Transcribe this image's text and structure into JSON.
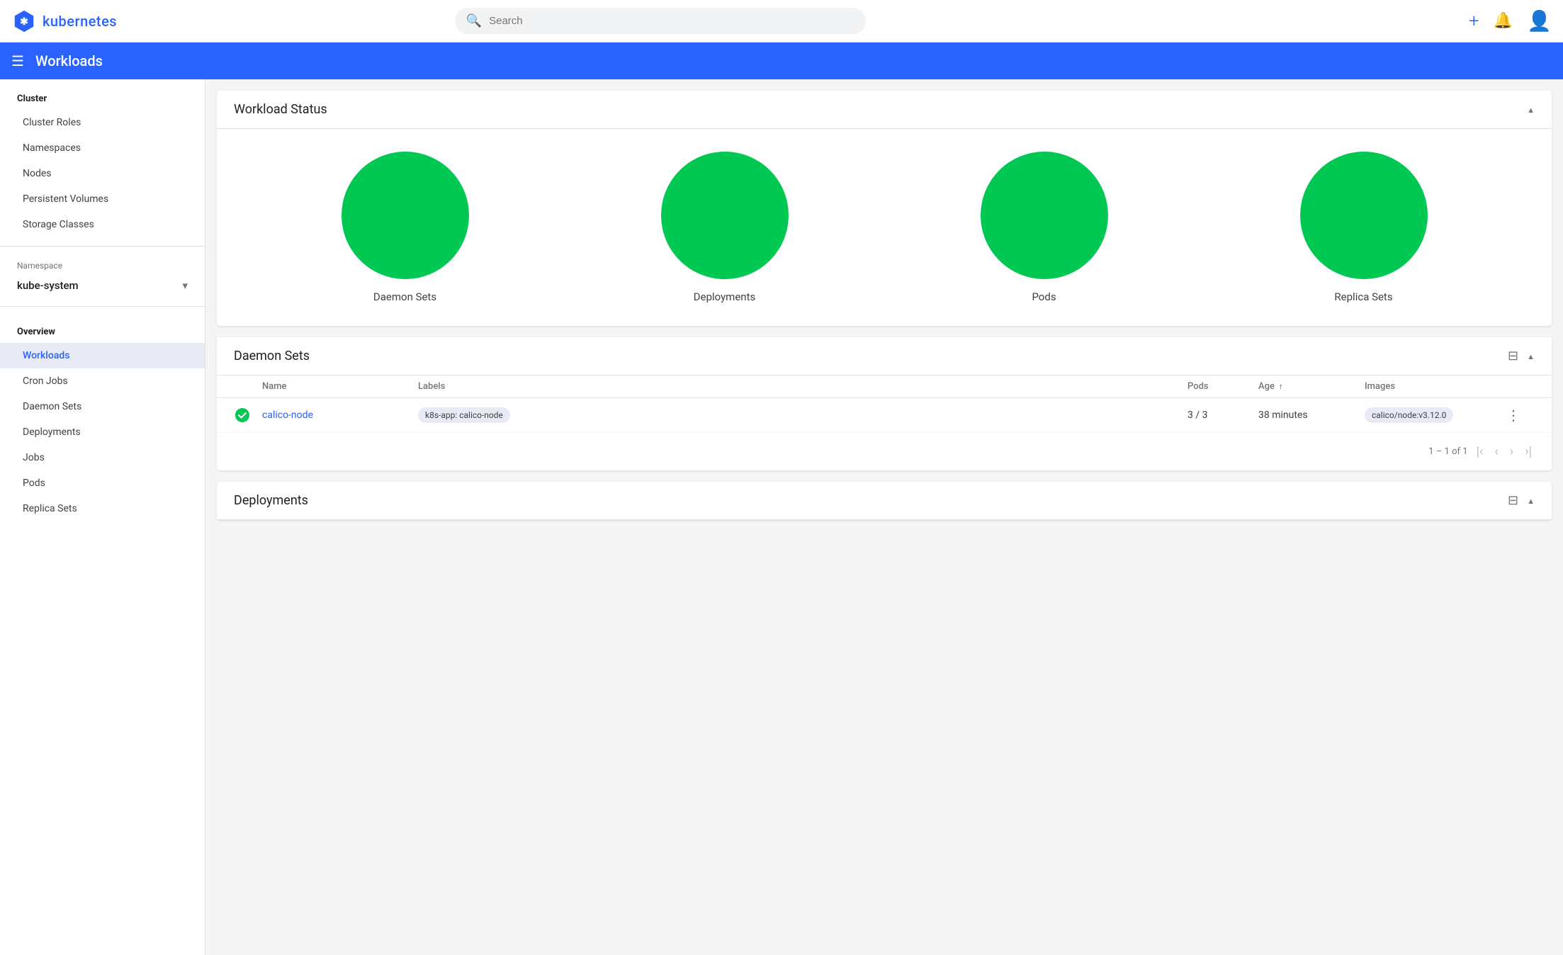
{
  "topbar": {
    "logo_text": "kubernetes",
    "search_placeholder": "Search"
  },
  "navbar": {
    "title": "Workloads"
  },
  "sidebar": {
    "cluster_header": "Cluster",
    "cluster_items": [
      {
        "label": "Cluster Roles",
        "id": "cluster-roles"
      },
      {
        "label": "Namespaces",
        "id": "namespaces"
      },
      {
        "label": "Nodes",
        "id": "nodes"
      },
      {
        "label": "Persistent Volumes",
        "id": "persistent-volumes"
      },
      {
        "label": "Storage Classes",
        "id": "storage-classes"
      }
    ],
    "namespace_label": "Namespace",
    "namespace_value": "kube-system",
    "overview_header": "Overview",
    "overview_items": [
      {
        "label": "Workloads",
        "id": "workloads",
        "active": true
      },
      {
        "label": "Cron Jobs",
        "id": "cron-jobs"
      },
      {
        "label": "Daemon Sets",
        "id": "daemon-sets"
      },
      {
        "label": "Deployments",
        "id": "deployments"
      },
      {
        "label": "Jobs",
        "id": "jobs"
      },
      {
        "label": "Pods",
        "id": "pods"
      },
      {
        "label": "Replica Sets",
        "id": "replica-sets"
      }
    ]
  },
  "workload_status": {
    "title": "Workload Status",
    "items": [
      {
        "label": "Daemon Sets",
        "color": "#00c853",
        "size": 180
      },
      {
        "label": "Deployments",
        "color": "#00c853",
        "size": 180
      },
      {
        "label": "Pods",
        "color": "#00c853",
        "size": 180
      },
      {
        "label": "Replica Sets",
        "color": "#00c853",
        "size": 180
      }
    ]
  },
  "daemon_sets": {
    "title": "Daemon Sets",
    "columns": [
      "Name",
      "Labels",
      "Pods",
      "Age",
      "Images"
    ],
    "age_sort": "asc",
    "rows": [
      {
        "status": "ok",
        "name": "calico-node",
        "label": "k8s-app: calico-node",
        "pods": "3 / 3",
        "age": "38 minutes",
        "image": "calico/node:v3.12.0"
      }
    ],
    "pagination": {
      "range": "1 – 1 of 1",
      "first_disabled": true,
      "prev_disabled": true,
      "next_disabled": true,
      "last_disabled": true
    }
  },
  "deployments": {
    "title": "Deployments"
  },
  "icons": {
    "search": "🔍",
    "plus": "+",
    "bell": "🔔",
    "user": "👤",
    "hamburger": "☰",
    "chevron_down": "▾",
    "chevron_up": "▲",
    "filter": "⊟",
    "more_vert": "⋮",
    "first_page": "|‹",
    "prev_page": "‹",
    "next_page": "›",
    "last_page": "›|"
  }
}
